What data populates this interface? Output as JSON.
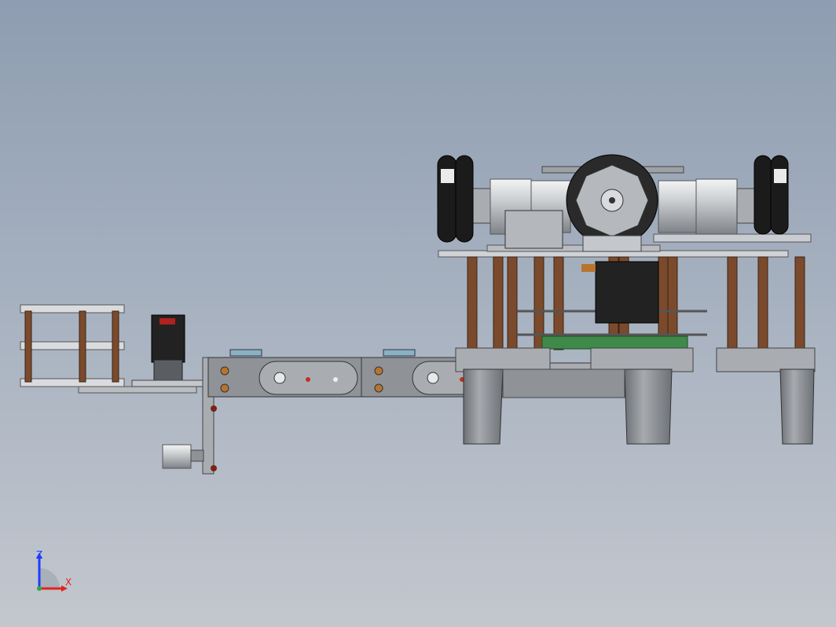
{
  "viewport": {
    "background_top": "#8e9db1",
    "background_bottom": "#c3c7ce"
  },
  "triad": {
    "z_label": "Z",
    "x_label": "X",
    "z_color": "#1f3cff",
    "x_color": "#e0241b"
  },
  "colors": {
    "metal": "#c9ccd0",
    "metal_dark": "#8f9398",
    "bracket": "#a9adb2",
    "wood": "#7b4a2c",
    "rubber": "#1b1b1b",
    "pcb": "#3f8a4a",
    "servo": "#222222"
  }
}
